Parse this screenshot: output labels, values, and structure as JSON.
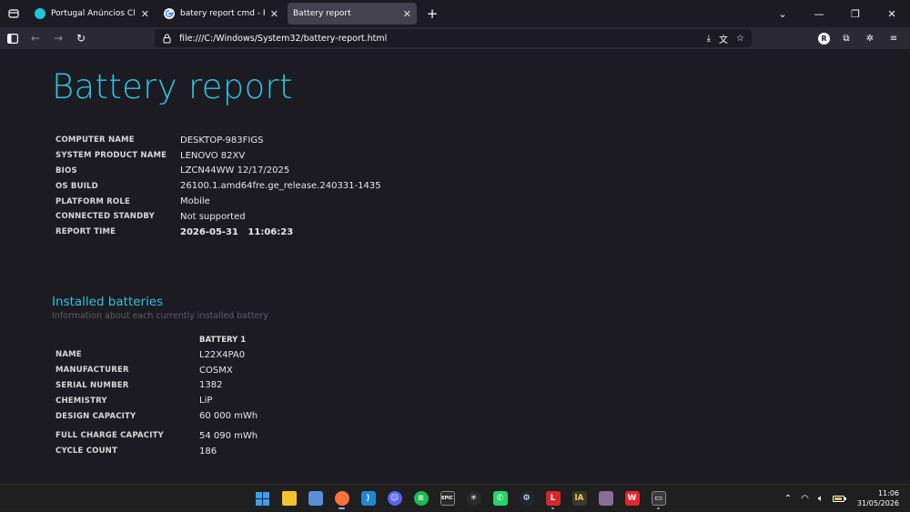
{
  "browser": {
    "tabs": [
      {
        "title": "Portugal Anúncios Classificados",
        "favicon_color": "#1ec8d6"
      },
      {
        "title": "batery report cmd - Pesquisa Google",
        "favicon_color": "#ffffff"
      },
      {
        "title": "Battery report",
        "favicon_color": ""
      }
    ],
    "new_tab_label": "+",
    "url": "file:///C:/Windows/System32/battery-report.html",
    "profile_initial": "R"
  },
  "report": {
    "title": "Battery report",
    "system_info": [
      {
        "key": "COMPUTER NAME",
        "value": "DESKTOP-983FIGS"
      },
      {
        "key": "SYSTEM PRODUCT NAME",
        "value": "LENOVO 82XV"
      },
      {
        "key": "BIOS",
        "value": "LZCN44WW 12/17/2025"
      },
      {
        "key": "OS BUILD",
        "value": "26100.1.amd64fre.ge_release.240331-1435"
      },
      {
        "key": "PLATFORM ROLE",
        "value": "Mobile"
      },
      {
        "key": "CONNECTED STANDBY",
        "value": "Not supported"
      },
      {
        "key": "REPORT TIME",
        "value": "2026-05-31   11:06:23"
      }
    ],
    "installed_batteries": {
      "title": "Installed batteries",
      "subtitle": "Information about each currently installed battery",
      "column_header": "BATTERY 1",
      "rows_a": [
        {
          "key": "NAME",
          "value": "L22X4PA0"
        },
        {
          "key": "MANUFACTURER",
          "value": "COSMX"
        },
        {
          "key": "SERIAL NUMBER",
          "value": "1382"
        },
        {
          "key": "CHEMISTRY",
          "value": "LiP"
        },
        {
          "key": "DESIGN CAPACITY",
          "value": "60 000 mWh"
        }
      ],
      "rows_b": [
        {
          "key": "FULL CHARGE CAPACITY",
          "value": "54 090 mWh"
        },
        {
          "key": "CYCLE COUNT",
          "value": "186"
        }
      ]
    }
  },
  "taskbar": {
    "apps": [
      {
        "name": "start-icon",
        "color": "#3aa0f0",
        "glyph": ""
      },
      {
        "name": "file-explorer-icon",
        "color": "#f2c230",
        "glyph": ""
      },
      {
        "name": "store-icon",
        "color": "#5a8fd8",
        "glyph": ""
      },
      {
        "name": "firefox-icon",
        "color": "#ff7139",
        "glyph": ""
      },
      {
        "name": "vscode-icon",
        "color": "#1f8ad2",
        "glyph": ""
      },
      {
        "name": "discord-icon",
        "color": "#5865f2",
        "glyph": ""
      },
      {
        "name": "spotify-icon",
        "color": "#1db954",
        "glyph": ""
      },
      {
        "name": "epic-games-icon",
        "color": "#2a2a2a",
        "glyph": "EPIC"
      },
      {
        "name": "spider-icon",
        "color": "#2a2a2a",
        "glyph": ""
      },
      {
        "name": "whatsapp-icon",
        "color": "#25d366",
        "glyph": ""
      },
      {
        "name": "steam-icon",
        "color": "#1b2838",
        "glyph": ""
      },
      {
        "name": "l-app-icon",
        "color": "#d8262b",
        "glyph": "L"
      },
      {
        "name": "la-app-icon",
        "color": "#3a3a2a",
        "glyph": "lA"
      },
      {
        "name": "card-app-icon",
        "color": "#8a6d9a",
        "glyph": ""
      },
      {
        "name": "wps-icon",
        "color": "#e2262b",
        "glyph": "W"
      },
      {
        "name": "terminal-icon",
        "color": "#3a3a3a",
        "glyph": ""
      }
    ],
    "time": "11:06",
    "date": "31/05/2026"
  }
}
